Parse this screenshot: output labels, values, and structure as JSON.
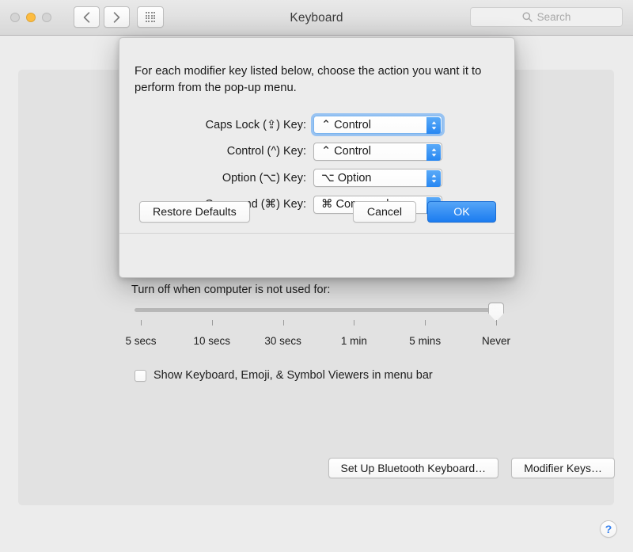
{
  "window": {
    "title": "Keyboard",
    "traffic_lights": [
      {
        "name": "close",
        "color": "#d4d4d4"
      },
      {
        "name": "minimize",
        "color": "#fdbc40"
      },
      {
        "name": "zoom",
        "color": "#d4d4d4"
      }
    ],
    "nav": {
      "back_icon": "chevron-left-icon",
      "forward_icon": "chevron-right-icon",
      "grid_icon": "show-all-grid-icon"
    },
    "search": {
      "placeholder": "Search",
      "value": "",
      "icon": "search-icon"
    }
  },
  "background": {
    "slider_label": "Turn off when computer is not used for:",
    "slider": {
      "tick_labels": [
        "5 secs",
        "10 secs",
        "30 secs",
        "1 min",
        "5 mins",
        "Never"
      ],
      "selected": "Never",
      "value_index": 5,
      "tick_count": 6
    },
    "checkbox": {
      "label": "Show Keyboard, Emoji, & Symbol Viewers in menu bar",
      "checked": false
    },
    "buttons": [
      {
        "name": "set-up-bluetooth-keyboard-button",
        "label": "Set Up Bluetooth Keyboard…"
      },
      {
        "name": "modifier-keys-button",
        "label": "Modifier Keys…"
      }
    ],
    "help_button": {
      "glyph": "?",
      "color": "#2f7dee"
    }
  },
  "dialog": {
    "intro": "For each modifier key listed below, choose the action you want it to perform from the pop-up menu.",
    "rows": [
      {
        "name": "caps-lock",
        "label": "Caps Lock (⇪) Key:",
        "value": "⌃ Control",
        "focused": true
      },
      {
        "name": "control",
        "label": "Control (^) Key:",
        "value": "⌃ Control",
        "focused": false
      },
      {
        "name": "option",
        "label": "Option (⌥) Key:",
        "value": "⌥ Option",
        "focused": false
      },
      {
        "name": "command",
        "label": "Command (⌘) Key:",
        "value": "⌘ Command",
        "focused": false
      }
    ],
    "buttons": {
      "restore": "Restore Defaults",
      "cancel": "Cancel",
      "ok": "OK"
    },
    "accent_color": "#2787f2"
  }
}
